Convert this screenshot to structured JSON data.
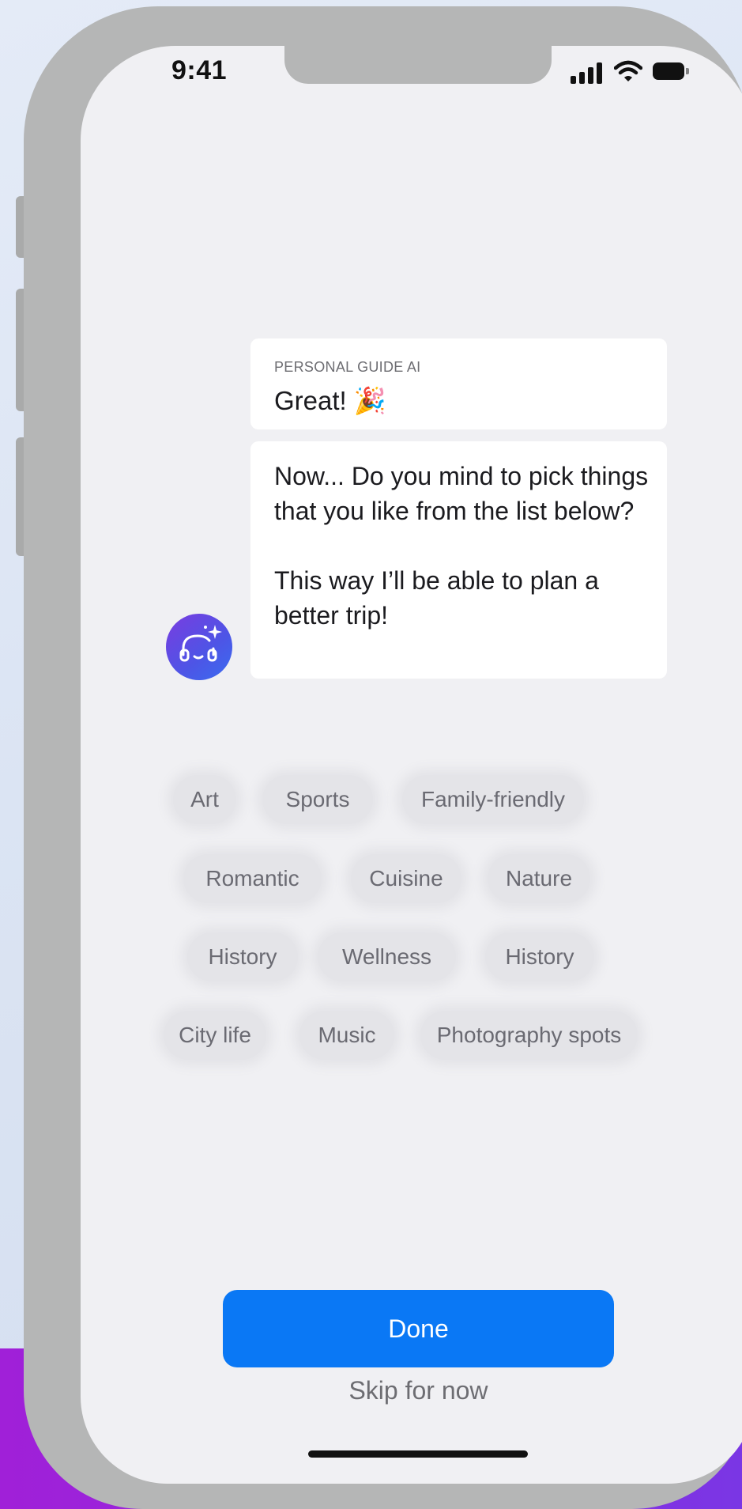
{
  "status_bar": {
    "time": "9:41"
  },
  "chat": {
    "sender": "PERSONAL GUIDE AI",
    "greeting": "Great! 🎉",
    "message": "Now... Do you mind to pick things that you like from the list below?\n\nThis way I’ll be able to plan a better trip!",
    "avatar_icon": "headset-sparkle-icon"
  },
  "interests": [
    "Art",
    "Sports",
    "Family-friendly",
    "Romantic",
    "Cuisine",
    "Nature",
    "History",
    "Wellness",
    "History",
    "City life",
    "Music",
    "Photography spots"
  ],
  "actions": {
    "done_label": "Done",
    "skip_label": "Skip for now"
  },
  "colors": {
    "accent": "#0a78f5",
    "avatar_gradient_start": "#7a3ce0",
    "avatar_gradient_end": "#3a6cf0",
    "backdrop_purple": "#a020d8"
  }
}
